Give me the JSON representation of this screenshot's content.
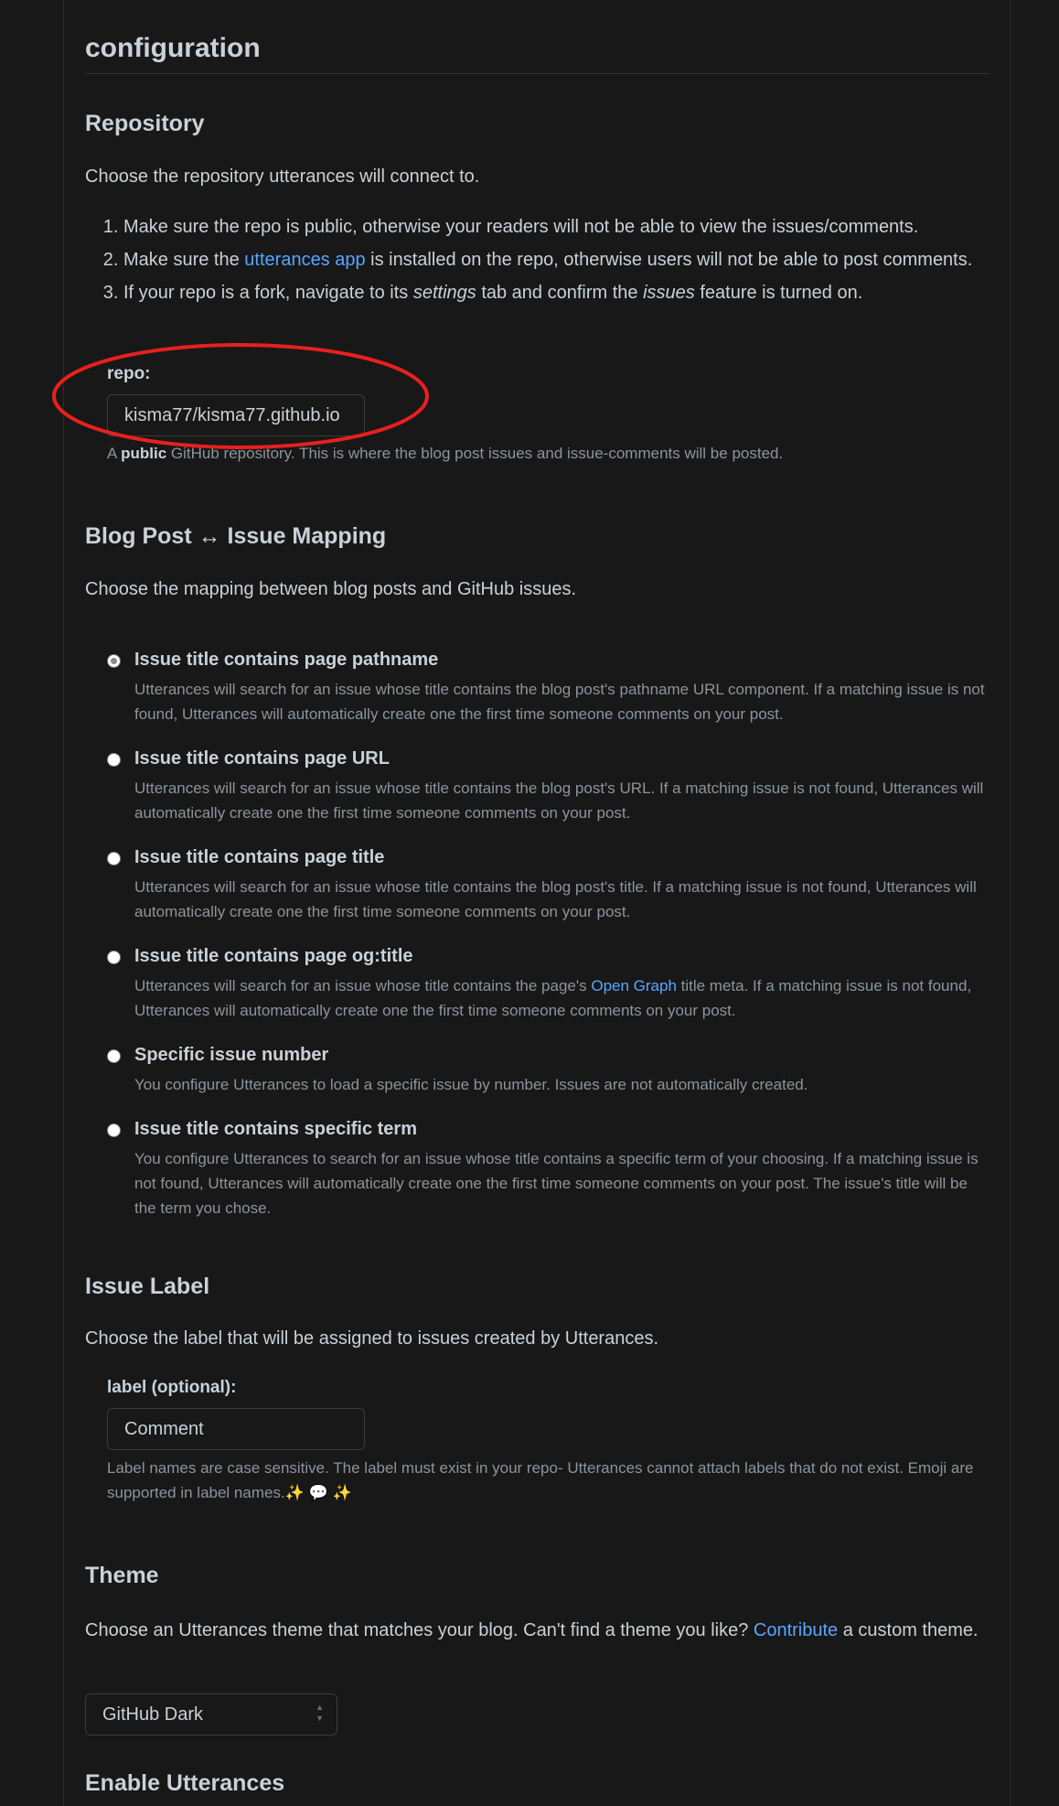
{
  "title": "configuration",
  "repository": {
    "heading": "Repository",
    "lead": "Choose the repository utterances will connect to.",
    "steps": [
      {
        "text": "Make sure the repo is public, otherwise your readers will not be able to view the issues/comments."
      },
      {
        "pre": "Make sure the ",
        "link": "utterances app",
        "post": " is installed on the repo, otherwise users will not be able to post comments."
      },
      {
        "pre": "If your repo is a fork, navigate to its ",
        "em1": "settings",
        "mid": " tab and confirm the ",
        "em2": "issues",
        "post": " feature is turned on."
      }
    ],
    "field_label": "repo:",
    "field_value": "kisma77/kisma77.github.io",
    "note_pre": "A ",
    "note_strong": "public",
    "note_post": " GitHub repository. This is where the blog post issues and issue-comments will be posted."
  },
  "mapping": {
    "heading": "Blog Post ↔ Issue Mapping",
    "lead": "Choose the mapping between blog posts and GitHub issues.",
    "options": [
      {
        "title": "Issue title contains page pathname",
        "desc": "Utterances will search for an issue whose title contains the blog post's pathname URL component. If a matching issue is not found, Utterances will automatically create one the first time someone comments on your post.",
        "checked": true
      },
      {
        "title": "Issue title contains page URL",
        "desc": "Utterances will search for an issue whose title contains the blog post's URL. If a matching issue is not found, Utterances will automatically create one the first time someone comments on your post.",
        "checked": false
      },
      {
        "title": "Issue title contains page title",
        "desc": "Utterances will search for an issue whose title contains the blog post's title. If a matching issue is not found, Utterances will automatically create one the first time someone comments on your post.",
        "checked": false
      },
      {
        "title": "Issue title contains page og:title",
        "desc_pre": "Utterances will search for an issue whose title contains the page's ",
        "desc_link": "Open Graph",
        "desc_post": " title meta. If a matching issue is not found, Utterances will automatically create one the first time someone comments on your post.",
        "checked": false
      },
      {
        "title": "Specific issue number",
        "desc": "You configure Utterances to load a specific issue by number. Issues are not automatically created.",
        "checked": false
      },
      {
        "title": "Issue title contains specific term",
        "desc": "You configure Utterances to search for an issue whose title contains a specific term of your choosing. If a matching issue is not found, Utterances will automatically create one the first time someone comments on your post. The issue's title will be the term you chose.",
        "checked": false
      }
    ]
  },
  "label": {
    "heading": "Issue Label",
    "lead": "Choose the label that will be assigned to issues created by Utterances.",
    "field_label": "label (optional):",
    "field_value": "Comment",
    "note": "Label names are case sensitive. The label must exist in your repo- Utterances cannot attach labels that do not exist. Emoji are supported in label names.✨ 💬 ✨"
  },
  "theme": {
    "heading": "Theme",
    "lead_pre": "Choose an Utterances theme that matches your blog. Can't find a theme you like? ",
    "lead_link": "Contribute",
    "lead_post": " a custom theme.",
    "selected": "GitHub Dark"
  },
  "enable": {
    "heading": "Enable Utterances"
  },
  "colors": {
    "background": "#181818",
    "text": "#c9d1d9",
    "muted": "#8b949e",
    "link": "#58a6ff",
    "annotation": "#e8201e"
  }
}
